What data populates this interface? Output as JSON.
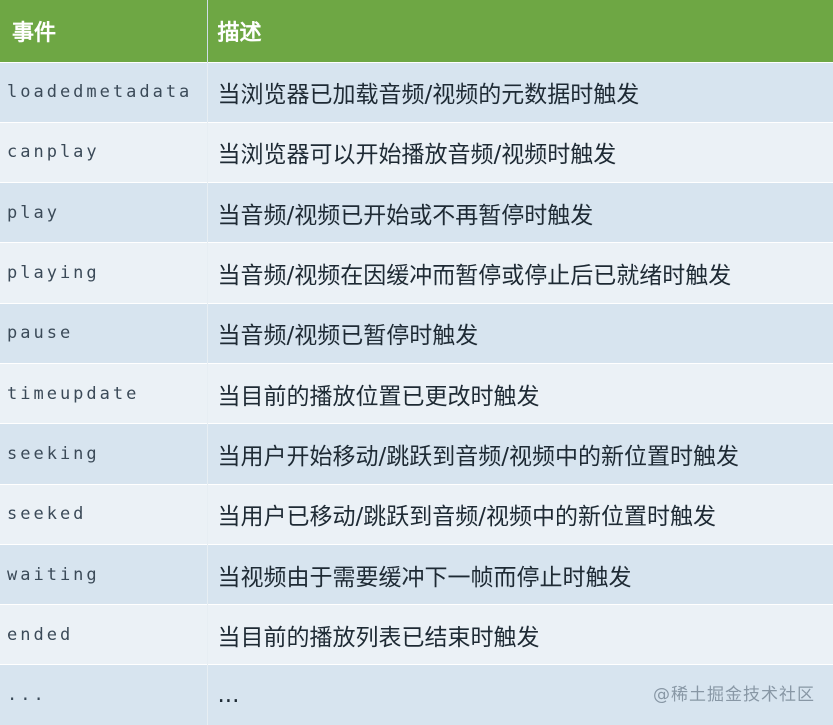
{
  "table": {
    "header": {
      "event": "事件",
      "description": "描述"
    },
    "rows": [
      {
        "event": "loadedmetadata",
        "description": "当浏览器已加载音频/视频的元数据时触发"
      },
      {
        "event": "canplay",
        "description": "当浏览器可以开始播放音频/视频时触发"
      },
      {
        "event": "play",
        "description": "当音频/视频已开始或不再暂停时触发"
      },
      {
        "event": "playing",
        "description": "当音频/视频在因缓冲而暂停或停止后已就绪时触发"
      },
      {
        "event": "pause",
        "description": "当音频/视频已暂停时触发"
      },
      {
        "event": "timeupdate",
        "description": "当目前的播放位置已更改时触发"
      },
      {
        "event": "seeking",
        "description": "当用户开始移动/跳跃到音频/视频中的新位置时触发"
      },
      {
        "event": "seeked",
        "description": "当用户已移动/跳跃到音频/视频中的新位置时触发"
      },
      {
        "event": "waiting",
        "description": "当视频由于需要缓冲下一帧而停止时触发"
      },
      {
        "event": "ended",
        "description": "当目前的播放列表已结束时触发"
      },
      {
        "event": "...",
        "description": "..."
      }
    ],
    "header_color": "#6ea744",
    "row_color_odd": "#d7e4ef",
    "row_color_even": "#ebf1f6"
  },
  "watermark": "@稀土掘金技术社区"
}
